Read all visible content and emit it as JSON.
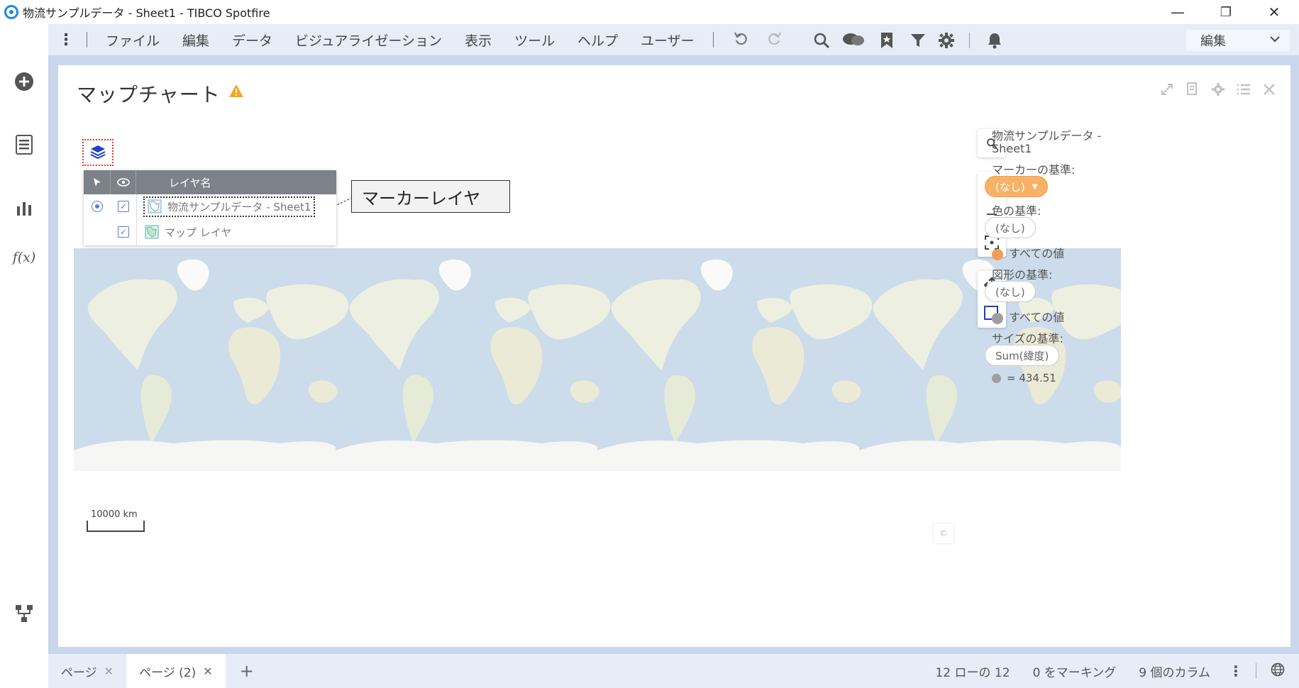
{
  "window": {
    "title": "物流サンプルデータ - Sheet1 - TIBCO Spotfire",
    "minimize": "—",
    "restore": "❐",
    "close": "✕"
  },
  "menu": {
    "items": [
      "ファイル",
      "編集",
      "データ",
      "ビジュアライゼーション",
      "表示",
      "ツール",
      "ヘルプ",
      "ユーザー"
    ],
    "mode_dropdown": "編集"
  },
  "viz": {
    "title": "マップチャート",
    "layer_panel": {
      "header_name": "レイヤ名",
      "layers": [
        {
          "name": "物流サンプルデータ - Sheet1",
          "selected": true,
          "visible": true
        },
        {
          "name": "マップ レイヤ",
          "selected": false,
          "visible": true
        }
      ]
    },
    "callout": "マーカーレイヤ",
    "scale": "10000 km",
    "copyright": "©"
  },
  "legend": {
    "source": "物流サンプルデータ -",
    "source_line2": "Sheet1",
    "marker_by_label": "マーカーの基準:",
    "marker_by_value": "(なし)",
    "color_by_label": "色の基準:",
    "color_by_value": "(なし)",
    "color_all": "すべての値",
    "shape_by_label": "図形の基準:",
    "shape_by_value": "(なし)",
    "shape_all": "すべての値",
    "size_by_label": "サイズの基準:",
    "size_by_value": "Sum(緯度)",
    "size_value": "= 434.51",
    "colors": {
      "marker_pill": "#f7b267",
      "color_dot": "#f39c5a",
      "shape_dot": "#9e9e9e"
    }
  },
  "status": {
    "tabs": [
      {
        "label": "ページ",
        "active": false
      },
      {
        "label": "ページ (2)",
        "active": true
      }
    ],
    "add": "+",
    "rows": "12 ローの 12",
    "marked": "0 をマーキング",
    "columns": "9 個のカラム"
  }
}
